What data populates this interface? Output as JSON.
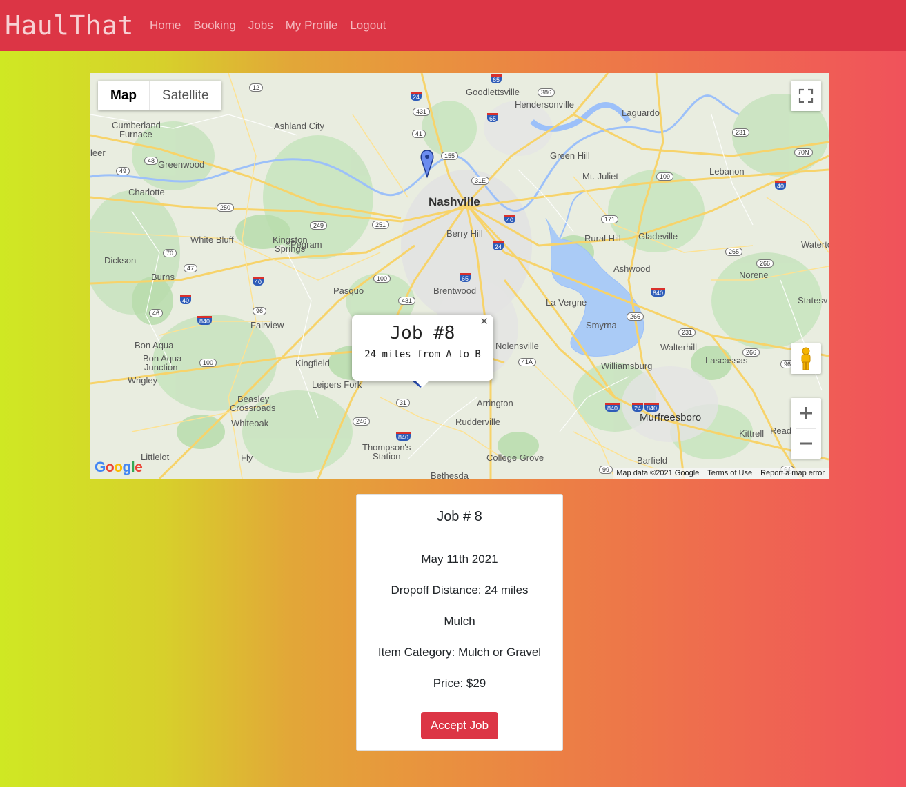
{
  "navbar": {
    "brand": "HaulThat",
    "links": [
      "Home",
      "Booking",
      "Jobs",
      "My Profile",
      "Logout"
    ],
    "bg_color": "#dc3545"
  },
  "map": {
    "map_type": [
      "Map",
      "Satellite"
    ],
    "selected_type": "Map",
    "info_window": {
      "title": "Job #8",
      "text": "24 miles from A to B"
    },
    "places": {
      "nashville": "Nashville",
      "goodlettsville": "Goodlettsville",
      "hendersonville": "Hendersonville",
      "laguardo": "Laguardo",
      "ashland_city": "Ashland City",
      "cumberland_furnace_1": "Cumberland",
      "cumberland_furnace_2": "Furnace",
      "greenwood": "Greenwood",
      "charlotte": "Charlotte",
      "green_hill": "Green Hill",
      "mt_juliet": "Mt. Juliet",
      "lebanon": "Lebanon",
      "berry_hill": "Berry Hill",
      "white_bluff": "White Bluff",
      "kingston_springs_1": "Kingston",
      "kingston_springs_2": "Springs",
      "pegram": "Pegram",
      "dickson": "Dickson",
      "burns": "Burns",
      "rural_hill": "Rural Hill",
      "gladeville": "Gladeville",
      "watertown": "Watertow",
      "ashwood": "Ashwood",
      "norene": "Norene",
      "pasquo": "Pasquo",
      "brentwood": "Brentwood",
      "la_vergne": "La Vergne",
      "statesville": "Statesv",
      "fairview": "Fairview",
      "smyrna": "Smyrna",
      "bon_aqua": "Bon Aqua",
      "bon_aqua_junction_1": "Bon Aqua",
      "bon_aqua_junction_2": "Junction",
      "kingfield": "Kingfield",
      "nolensville": "Nolensville",
      "walterhill": "Walterhill",
      "lascassas": "Lascassas",
      "williamsburg": "Williamsburg",
      "wrigley": "Wrigley",
      "leipers_fork": "Leipers Fork",
      "arrington": "Arrington",
      "beasley_crossroads_1": "Beasley",
      "beasley_crossroads_2": "Crossroads",
      "whiteoak": "Whiteoak",
      "rudderville": "Rudderville",
      "murfreesboro": "Murfreesboro",
      "kittrell": "Kittrell",
      "read": "Read",
      "thompsons_station_1": "Thompson's",
      "thompsons_station_2": "Station",
      "littlelot": "Littlelot",
      "fly": "Fly",
      "college_grove": "College Grove",
      "barfield": "Barfield",
      "bethesda": "Bethesda",
      "leer": "leer"
    },
    "shields": [
      "12",
      "24",
      "65",
      "386",
      "431",
      "41",
      "155",
      "65",
      "31E",
      "48",
      "49",
      "250",
      "231",
      "70N",
      "109",
      "40",
      "40",
      "251",
      "249",
      "171",
      "70",
      "47",
      "100",
      "65",
      "24",
      "265",
      "266",
      "40",
      "40",
      "840",
      "96",
      "431",
      "266",
      "840",
      "231",
      "100",
      "46",
      "41A",
      "266",
      "96",
      "840",
      "31",
      "246",
      "840",
      "840",
      "24",
      "99",
      "64"
    ],
    "attribution": [
      "Map data ©2021 Google",
      "Terms of Use",
      "Report a map error"
    ],
    "logo": "Google"
  },
  "job_card": {
    "title": "Job # 8",
    "date": "May 11th 2021",
    "dropoff": "Dropoff Distance: 24 miles",
    "item": "Mulch",
    "category": "Item Category: Mulch or Gravel",
    "price": "Price: $29",
    "accept_label": "Accept Job"
  }
}
